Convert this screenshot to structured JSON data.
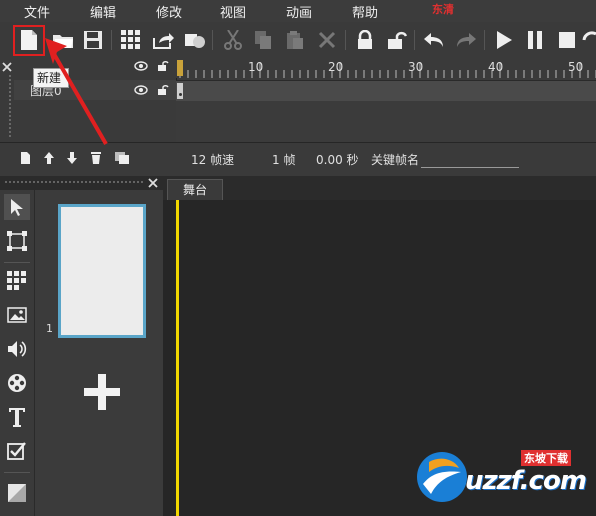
{
  "menu": {
    "items": [
      "文件",
      "编辑",
      "修改",
      "视图",
      "动画",
      "帮助"
    ],
    "brand_text": "东清"
  },
  "toolbar": {
    "buttons": [
      {
        "name": "new-file-icon",
        "tooltip": "新建"
      },
      {
        "name": "open-folder-icon"
      },
      {
        "name": "save-icon"
      },
      {
        "name": "grid-icon"
      },
      {
        "name": "export-icon"
      },
      {
        "name": "shapes-icon"
      },
      {
        "name": "cut-icon"
      },
      {
        "name": "copy-icon"
      },
      {
        "name": "paste-icon"
      },
      {
        "name": "delete-icon"
      },
      {
        "name": "lock-icon"
      },
      {
        "name": "unlock-icon"
      },
      {
        "name": "undo-icon"
      },
      {
        "name": "redo-icon"
      },
      {
        "name": "play-icon"
      },
      {
        "name": "pause-icon"
      },
      {
        "name": "stop-icon"
      },
      {
        "name": "loop-icon"
      }
    ],
    "tooltip_text": "新建"
  },
  "timeline": {
    "layer_name": "图层0",
    "ruler_labels": [
      "10",
      "20",
      "30",
      "40",
      "50"
    ]
  },
  "status": {
    "fps": "12 帧速",
    "frame": "1 帧",
    "time": "0.00 秒",
    "keyframe_label": "关键帧名"
  },
  "pages": {
    "current_number": "1"
  },
  "stage": {
    "tab_label": "舞台"
  },
  "watermark": {
    "text": "uzzf.com",
    "tagline": "东坡下载"
  },
  "colors": {
    "highlight": "#e02020",
    "selection": "#5aa5c8",
    "stage_edge": "#f2d700"
  }
}
